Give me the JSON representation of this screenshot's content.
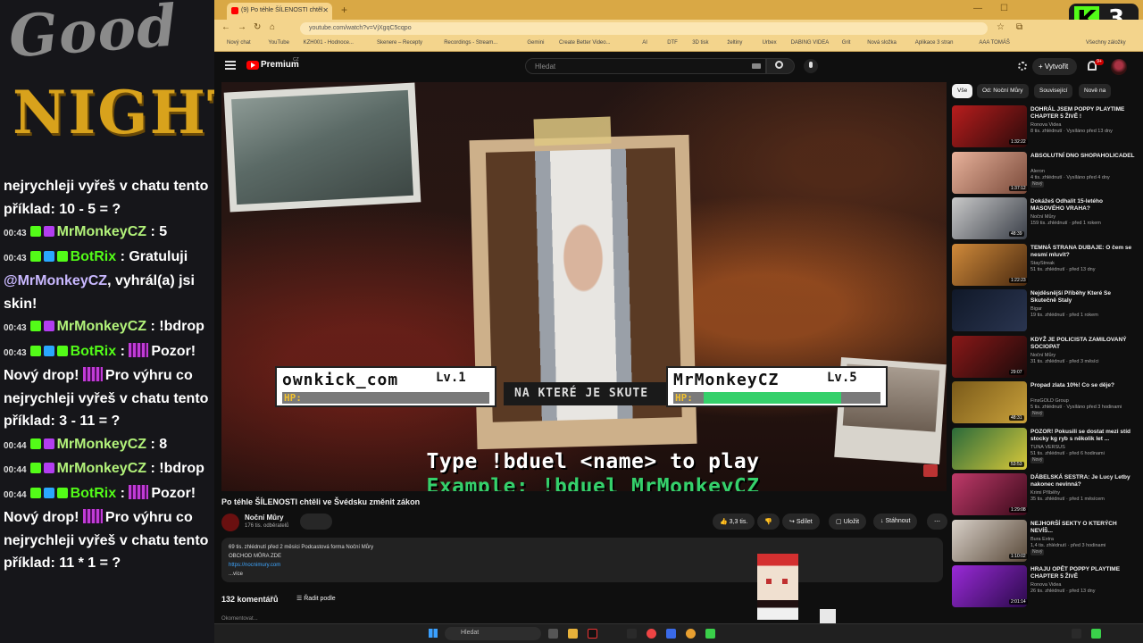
{
  "overlay": {
    "good": "Good",
    "night": "NIGHT",
    "messages": [
      {
        "ts": "",
        "user": "",
        "text": "nejrychleji vyřeš v chatu tento příklad: 10 - 5 = ?"
      },
      {
        "ts": "00:43",
        "user": "MrMonkeyCZ",
        "sep": " : ",
        "text": "5"
      },
      {
        "ts": "00:43",
        "user": "BotRix",
        "sep": " : ",
        "text": "Gratuluji ",
        "mention": "@MrMonkeyCZ",
        "text2": ", vyhrál(a) jsi skin!"
      },
      {
        "ts": "00:43",
        "user": "MrMonkeyCZ",
        "sep": " : ",
        "text": "!bdrop"
      },
      {
        "ts": "00:43",
        "user": "BotRix",
        "sep": " : ",
        "text": "Pozor! Nový drop!",
        "text2": "Pro výhru co nejrychleji vyřeš v chatu tento příklad: 3 - 11 = ?"
      },
      {
        "ts": "00:44",
        "user": "MrMonkeyCZ",
        "sep": " : ",
        "text": "8"
      },
      {
        "ts": "00:44",
        "user": "MrMonkeyCZ",
        "sep": " : ",
        "text": "!bdrop"
      },
      {
        "ts": "00:44",
        "user": "BotRix",
        "sep": " : ",
        "text": "Pozor! Nový drop!",
        "text2": "Pro výhru co nejrychleji vyřeš v chatu tento příklad: 11 * 1 = ?"
      }
    ]
  },
  "kick": {
    "letter": "K",
    "count": "3"
  },
  "browser": {
    "tab_title": "(9) Po téhle ŠÍLENOSTI chtěl",
    "url": "youtube.com/watch?v=VjXgqC5cqpo",
    "bookmarks": [
      "Nový chat",
      "YouTube",
      "KZH001 - Hodnoce...",
      "Skenere – Recepty",
      "Recordings - Stream...",
      "Gemini",
      "Create Better Video...",
      "AI",
      "DTF",
      "3D tisk",
      "želtiny",
      "Urbex",
      "DABING VIDEA",
      "Grit",
      "Nová složka",
      "Aplikace 3 stran",
      "AAA TOMÁŠ",
      "Všechny záložky"
    ]
  },
  "youtube": {
    "premium": "Premium",
    "region": "CZ",
    "search_placeholder": "Hledat",
    "create_label": "+ Vytvořit",
    "notif_count": "9+",
    "video": {
      "player1_name": "ownkick_com",
      "player1_lv": "Lv.1",
      "player1_hp": 0.0,
      "player2_name": "MrMonkeyCZ",
      "player2_lv": "Lv.5",
      "player2_hp": 0.78,
      "hp_label": "HP:",
      "banner_text": "NA KTERÉ JE SKUTE",
      "type_line": "Type !bduel <name> to play",
      "example_line": "Example: !bduel MrMonkeyCZ"
    },
    "title": "Po téhle ŠÍLENOSTI chtěli ve Švédsku změnit zákon",
    "channel": "Noční Můry",
    "subs": "176 tis. odběratelů",
    "likes": "3,3 tis.",
    "share": "Sdílet",
    "save": "Uložit",
    "download": "Stáhnout",
    "description": {
      "line1": "69 tis. zhlédnutí  před 2 měsíci  Podcastová forma Noční Můry",
      "line2": "OBCHOD MŮRA ZDE",
      "link": "https://nocnimury.com",
      "more": "...více"
    },
    "comments": "132 komentářů",
    "sort": "Řadit podle",
    "comment_placeholder": "Okomentovat...",
    "chips": [
      "Vše",
      "Od: Noční Můry",
      "Související",
      "Nově na"
    ],
    "recs": [
      {
        "title": "DOHRÁL JSEM POPPY PLAYTIME CHAPTER 5 ŽIVĚ !",
        "channel": "Ronova Videa",
        "meta": "8 tis. zhlédnutí · Vysíláno před 13 dny",
        "dur": "1:32:22",
        "badge": "",
        "c1": "#b81d1d",
        "c2": "#2b0a0a"
      },
      {
        "title": "ABSOLUTNÍ DNO SHOPAHOLICADEL",
        "channel": "Aleron",
        "meta": "4 tis. zhlédnutí · Vysíláno před 4 dny",
        "dur": "1:37:12",
        "badge": "Nový",
        "c1": "#e8b29b",
        "c2": "#7a4a3a"
      },
      {
        "title": "Dokážeš Odhalit 15-letého MASOVÉHO VRAHA?",
        "channel": "Noční Můry",
        "meta": "159 tis. zhlédnutí · před 1 rokem",
        "dur": "48:39",
        "badge": "",
        "c1": "#c9c9c9",
        "c2": "#3a3f48"
      },
      {
        "title": "TEMNÁ STRANA DUBAJE: O čem se nesmí mluvit?",
        "channel": "StayStreak",
        "meta": "51 tis. zhlédnutí · před 13 dny",
        "dur": "1:22:23",
        "badge": "",
        "c1": "#d08a3a",
        "c2": "#4a2a10"
      },
      {
        "title": "Nejděsnější Příběhy Které Se Skutečně Staly",
        "channel": "Bigar",
        "meta": "19 tis. zhlédnutí · před 1 rokem",
        "dur": "",
        "badge": "",
        "c1": "#101828",
        "c2": "#2a3550"
      },
      {
        "title": "KDYŽ JE POLICISTA ZAMILOVANÝ SOCIOPAT",
        "channel": "Noční Můry",
        "meta": "31 tis. zhlédnutí · před 3 měsíci",
        "dur": "29:07",
        "badge": "",
        "c1": "#8a1818",
        "c2": "#1a0a0a"
      },
      {
        "title": "Propad zlata 10%! Co se děje?",
        "channel": "FinsGOLD Group",
        "meta": "5 tis. zhlédnutí · Vysíláno před 3 hodinami",
        "dur": "48:31",
        "badge": "Nový",
        "c1": "#7a5a1a",
        "c2": "#c9a13a"
      },
      {
        "title": "POZOR! Pokusili se dostat mezi stíd stocky kg ryb s několik let ...",
        "channel": "TUNA VERSUS",
        "meta": "51 tis. zhlédnutí · před 6 hodinami",
        "dur": "53:53",
        "badge": "Nový",
        "c1": "#2a6a3a",
        "c2": "#d8c83a"
      },
      {
        "title": "DÁBELSKÁ SESTRA: Je Lucy Letby nakonec nevinná?",
        "channel": "Krimi Příběhy",
        "meta": "35 tis. zhlédnutí · před 1 měsícem",
        "dur": "1:29:08",
        "badge": "",
        "c1": "#c03a6a",
        "c2": "#3a0a1a"
      },
      {
        "title": "NEJHORŠÍ SEKTY O KTERÝCH NEVÍŠ...",
        "channel": "Bura Extra",
        "meta": "1,4 tis. zhlédnutí · před 3 hodinami",
        "dur": "1:10:02",
        "badge": "Nový",
        "c1": "#d8d0c8",
        "c2": "#5a4a3a"
      },
      {
        "title": "HRAJU OPĚT POPPY PLAYTIME CHAPTER 5 ŽIVĚ",
        "channel": "Ronova Videa",
        "meta": "26 tis. zhlédnutí · před 13 dny",
        "dur": "2:01:14",
        "badge": "",
        "c1": "#9a2ad8",
        "c2": "#2a0a4a"
      }
    ]
  },
  "taskbar": {
    "search": "Hledat"
  },
  "colors": {
    "kick_green": "#53fc18",
    "tab_bar": "#d9a845",
    "yt_red": "#ff0000",
    "hp_green": "#35d06b"
  }
}
